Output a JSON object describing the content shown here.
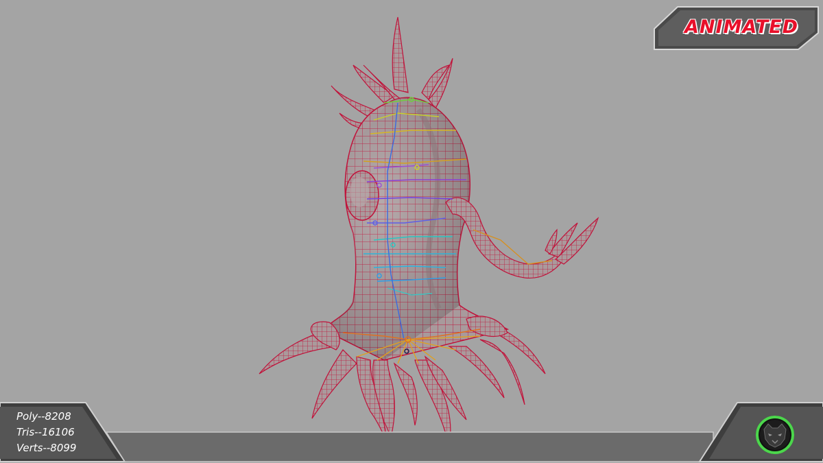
{
  "badge": {
    "label": "ANIMATED",
    "color": "#e8102a"
  },
  "stats": {
    "poly": "Poly--8208",
    "tris": "Tris--16106",
    "verts": "Verts--8099"
  },
  "logo": {
    "icon": "black-panther-head-icon",
    "ring_color": "#4cd64c"
  },
  "model": {
    "wire_color": "#c0123a",
    "surface_color": "#a89898"
  }
}
